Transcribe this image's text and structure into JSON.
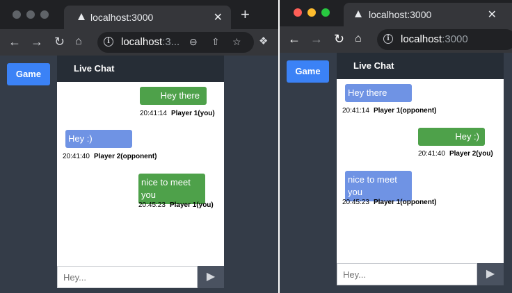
{
  "left_window": {
    "traffic_colors": [
      "#5f6368",
      "#5f6368",
      "#5f6368"
    ],
    "tab_title": "localhost:3000",
    "tab_close": "✕",
    "new_tab": "+",
    "url_host": "localhost",
    "url_port": ":3...",
    "game_label": "Game",
    "chat_title": "Live Chat",
    "input_placeholder": "Hey...",
    "send_glyph": "▶",
    "messages": [
      {
        "text": "Hey there",
        "time": "20:41:14",
        "sender": "Player 1(you)"
      },
      {
        "text": "Hey :)",
        "time": "20:41:40",
        "sender": "Player 2(opponent)"
      },
      {
        "text": "nice to meet you",
        "time": "20:45:23",
        "sender": "Player 1(you)"
      }
    ]
  },
  "right_window": {
    "traffic_colors": [
      "#ff5f57",
      "#febc2e",
      "#28c840"
    ],
    "tab_title": "localhost:3000",
    "tab_close": "✕",
    "url_host": "localhost",
    "url_port": ":3000",
    "game_label": "Game",
    "chat_title": "Live Chat",
    "input_placeholder": "Hey...",
    "send_glyph": "▶",
    "messages": [
      {
        "text": "Hey there",
        "time": "20:41:14",
        "sender": "Player 1(opponent)"
      },
      {
        "text": "Hey :)",
        "time": "20:41:40",
        "sender": "Player 2(you)"
      },
      {
        "text": "nice to meet you",
        "time": "20:45:23",
        "sender": "Player 1(opponent)"
      }
    ]
  },
  "colors": {
    "own_bubble": "#4ea14a",
    "other_bubble": "#6f93e4",
    "game_button": "#3b82f6",
    "app_bg": "#343c48"
  },
  "icons": {
    "back": "arrow-left-icon",
    "forward": "arrow-right-icon",
    "reload": "reload-icon",
    "home": "home-icon",
    "info": "info-icon",
    "zoom": "zoom-out-icon",
    "share": "share-icon",
    "bookmark": "star-icon",
    "extensions": "puzzle-icon",
    "send": "send-icon"
  }
}
